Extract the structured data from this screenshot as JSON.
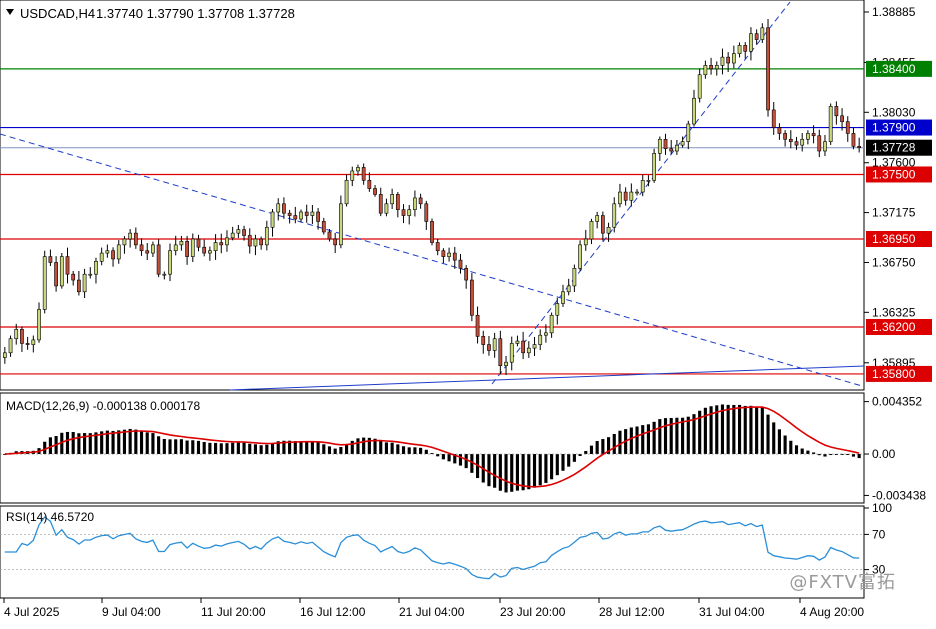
{
  "header": {
    "symbol_label": "USDCAD,H4",
    "ohlc": "1.37740 1.37790 1.37708 1.37728"
  },
  "macd_panel": {
    "label": "MACD(12,26,9) -0.000138 0.000178"
  },
  "rsi_panel": {
    "label": "RSI(14) 46.5720"
  },
  "watermark": "@FXTV富拓",
  "colors": {
    "bull": "#c8d87a",
    "bear": "#c0503c",
    "wick": "#000000",
    "support": "#dd0000",
    "resist_green": "#008000",
    "resist_blue": "#0000cc",
    "trend_blue": "#1e3cc8",
    "macd_signal": "#dd0000",
    "rsi_line": "#2a8fd8",
    "price_badge": "#000000"
  },
  "chart_data": [
    {
      "type": "candlestick",
      "title": "USDCAD,H4",
      "y_ticks": [
        "1.38885",
        "1.38455",
        "1.38030",
        "1.37600",
        "1.37175",
        "1.36750",
        "1.36325",
        "1.35895"
      ],
      "ylim": [
        1.3568,
        1.3897
      ],
      "x_tick_labels": [
        "4 Jul 2025",
        "9 Jul 04:00",
        "11 Jul 20:00",
        "16 Jul 12:00",
        "21 Jul 04:00",
        "23 Jul 20:00",
        "28 Jul 12:00",
        "31 Jul 04:00",
        "4 Aug 20:00"
      ],
      "horizontal_levels": [
        {
          "value": 1.384,
          "label": "1.38400",
          "color": "#008000"
        },
        {
          "value": 1.379,
          "label": "1.37900",
          "color": "#0000cc"
        },
        {
          "value": 1.375,
          "label": "1.37500",
          "color": "#dd0000"
        },
        {
          "value": 1.3695,
          "label": "1.36950",
          "color": "#dd0000"
        },
        {
          "value": 1.362,
          "label": "1.36200",
          "color": "#dd0000"
        },
        {
          "value": 1.358,
          "label": "1.35800",
          "color": "#dd0000"
        }
      ],
      "current_price": {
        "value": 1.37728,
        "label": "1.37728"
      },
      "closes": [
        1.3598,
        1.361,
        1.3618,
        1.3606,
        1.3605,
        1.3609,
        1.3635,
        1.368,
        1.3675,
        1.3655,
        1.368,
        1.3665,
        1.366,
        1.365,
        1.3665,
        1.3665,
        1.3676,
        1.3683,
        1.3685,
        1.3678,
        1.369,
        1.3695,
        1.37,
        1.369,
        1.3685,
        1.3683,
        1.369,
        1.3665,
        1.3665,
        1.3685,
        1.369,
        1.3693,
        1.368,
        1.3695,
        1.3688,
        1.3683,
        1.3685,
        1.3692,
        1.369,
        1.3696,
        1.37,
        1.3703,
        1.3698,
        1.3689,
        1.3695,
        1.369,
        1.3705,
        1.3718,
        1.3725,
        1.3717,
        1.3715,
        1.3712,
        1.3718,
        1.3715,
        1.3718,
        1.371,
        1.3701,
        1.3695,
        1.369,
        1.3725,
        1.3745,
        1.3753,
        1.3756,
        1.3745,
        1.3738,
        1.3733,
        1.3717,
        1.3725,
        1.3733,
        1.372,
        1.3715,
        1.372,
        1.373,
        1.3725,
        1.371,
        1.3692,
        1.3685,
        1.368,
        1.3683,
        1.3677,
        1.367,
        1.366,
        1.363,
        1.3612,
        1.3605,
        1.36,
        1.361,
        1.3587,
        1.359,
        1.3606,
        1.3608,
        1.3598,
        1.3602,
        1.3605,
        1.3613,
        1.3615,
        1.363,
        1.364,
        1.365,
        1.3655,
        1.367,
        1.369,
        1.3695,
        1.371,
        1.3715,
        1.37,
        1.3705,
        1.3725,
        1.3735,
        1.3728,
        1.3735,
        1.3735,
        1.3745,
        1.3745,
        1.3768,
        1.378,
        1.3772,
        1.377,
        1.3775,
        1.3778,
        1.3793,
        1.3815,
        1.3835,
        1.3843,
        1.384,
        1.3843,
        1.385,
        1.3845,
        1.3853,
        1.386,
        1.3855,
        1.387,
        1.3865,
        1.3875,
        1.3805,
        1.379,
        1.3785,
        1.378,
        1.3778,
        1.3775,
        1.378,
        1.3785,
        1.3783,
        1.377,
        1.3778,
        1.3808,
        1.38,
        1.3795,
        1.3785,
        1.3774,
        1.37728
      ],
      "macd_axis": {
        "ticks": [
          "0.004352",
          "0.00",
          "-0.003438"
        ],
        "ylim": [
          -0.0039,
          0.0049
        ]
      },
      "macd_signal_color": "#dd0000",
      "rsi_axis": {
        "ticks": [
          "100",
          "70",
          "30"
        ],
        "ylim": [
          0,
          100
        ],
        "levels": [
          70,
          30
        ]
      }
    }
  ]
}
